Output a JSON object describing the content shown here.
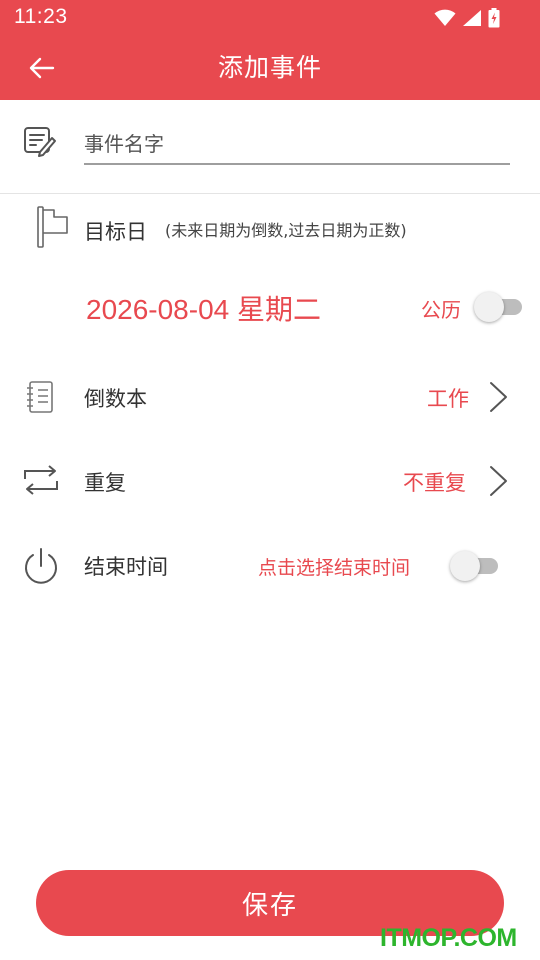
{
  "status_bar": {
    "time": "11:23"
  },
  "header": {
    "title": "添加事件"
  },
  "event_name": {
    "placeholder": "事件名字"
  },
  "target_day": {
    "label": "目标日",
    "hint": "(未来日期为倒数,过去日期为正数)",
    "date": "2026-08-04 星期二",
    "calendar_label": "公历"
  },
  "countdown_book": {
    "label": "倒数本",
    "value": "工作"
  },
  "repeat": {
    "label": "重复",
    "value": "不重复"
  },
  "end_time": {
    "label": "结束时间",
    "value": "点击选择结束时间"
  },
  "save_label": "保存",
  "watermark": "ITMOP.COM",
  "colors": {
    "accent": "#e8494f",
    "watermark": "#2db52d"
  }
}
